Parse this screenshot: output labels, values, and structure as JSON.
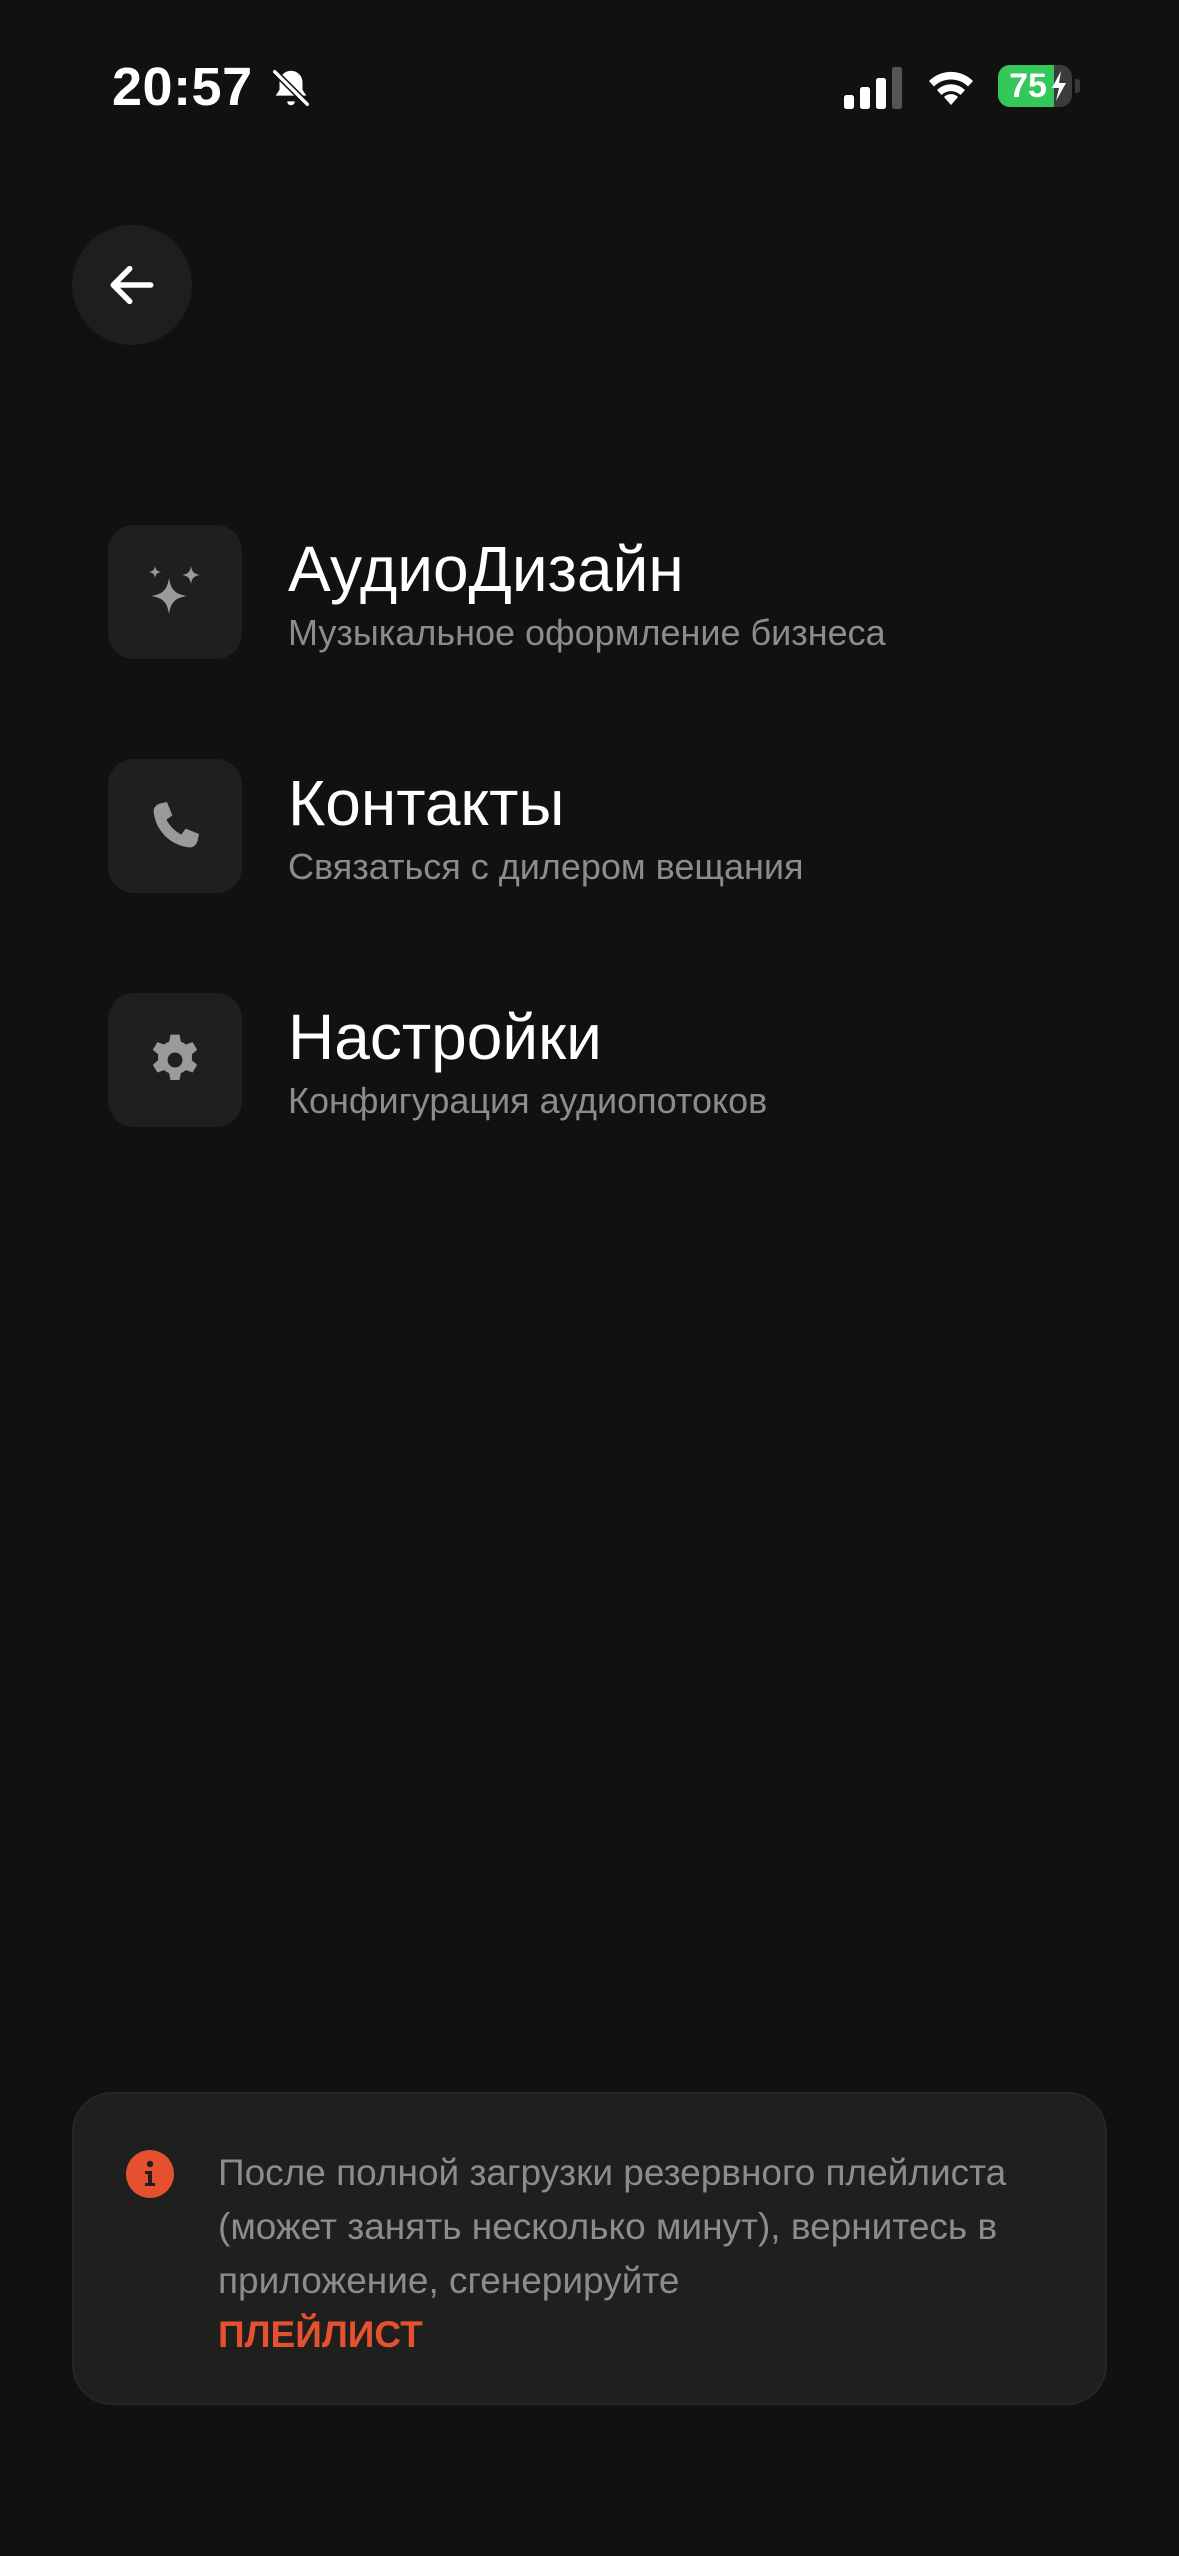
{
  "status_bar": {
    "time": "20:57",
    "battery_level": "75",
    "battery_fraction": 0.75,
    "icons": [
      "bell-slash-icon",
      "cellular-signal-icon",
      "wifi-icon",
      "battery-charging-icon"
    ]
  },
  "header": {
    "back_icon": "arrow-left-icon"
  },
  "menu": {
    "items": [
      {
        "icon": "sparkles-icon",
        "title": "АудиоДизайн",
        "subtitle": "Музыкальное оформление бизнеса"
      },
      {
        "icon": "phone-icon",
        "title": "Контакты",
        "subtitle": "Связаться с дилером вещания"
      },
      {
        "icon": "gear-icon",
        "title": "Настройки",
        "subtitle": "Конфигурация аудиопотоков"
      }
    ]
  },
  "info_card": {
    "icon": "info-icon",
    "message": "После полной загрузки резервного плейлиста (может занять несколько минут), вернитесь в приложение, сгенерируйте",
    "link_label": "ПЛЕЙЛИСТ"
  },
  "colors": {
    "background": "#111110",
    "surface": "#1f1f1e",
    "accent": "#e5512f",
    "battery_green": "#34c759",
    "text_secondary": "#8c8c8a"
  }
}
